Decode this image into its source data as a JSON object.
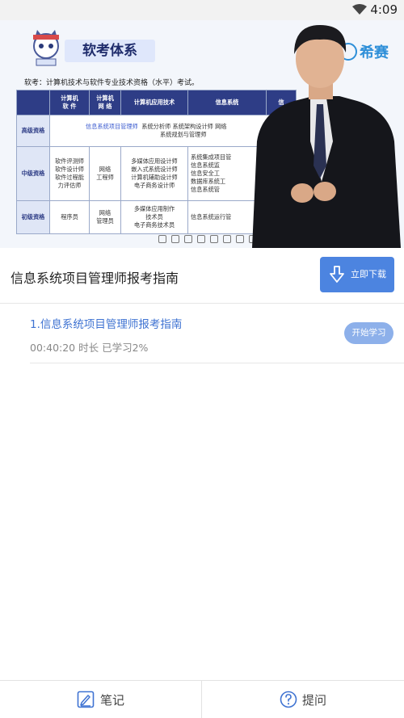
{
  "status_bar": {
    "time": "4:09"
  },
  "video": {
    "slide_title": "软考体系",
    "brand": "希赛",
    "subtitle": "软考：计算机技术与软件专业技术资格（水平）考试。",
    "table": {
      "headers": [
        "",
        "计算机\n软 件",
        "计算机\n网 络",
        "计算机应用技术",
        "信息系统",
        "信"
      ],
      "rows": [
        {
          "label": "高级资格",
          "cells": [
            "信息系统项目管理师",
            "系统分析师  系统架构设计师  网络",
            "系统规划与管理师"
          ]
        },
        {
          "label": "中级资格",
          "cells": [
            "软件评测师\n软件设计师\n软件过程能\n力评估师",
            "网络\n工程师",
            "多媒体应用设计师\n嵌入式系统设计师\n计算机辅助设计师\n电子商务设计师",
            "系统集成项目管\n信息系统监\n信息安全工\n数据库系统工\n信息系统管"
          ]
        },
        {
          "label": "初级资格",
          "cells": [
            "程序员",
            "网络\n管理员",
            "多媒体应用制作\n技术员\n电子商务技术员",
            "信息系统运行管"
          ]
        }
      ]
    }
  },
  "course": {
    "title": "信息系统项目管理师报考指南",
    "download_label": "立即下载"
  },
  "lesson": {
    "title": "1.信息系统项目管理师报考指南",
    "meta": "00:40:20 时长   已学习2%",
    "start_label": "开始学习"
  },
  "bottom_nav": {
    "notes_label": "笔记",
    "question_label": "提问"
  },
  "colors": {
    "accent": "#4c84e0",
    "link": "#3f73d2",
    "start_btn": "#8db0ea"
  }
}
